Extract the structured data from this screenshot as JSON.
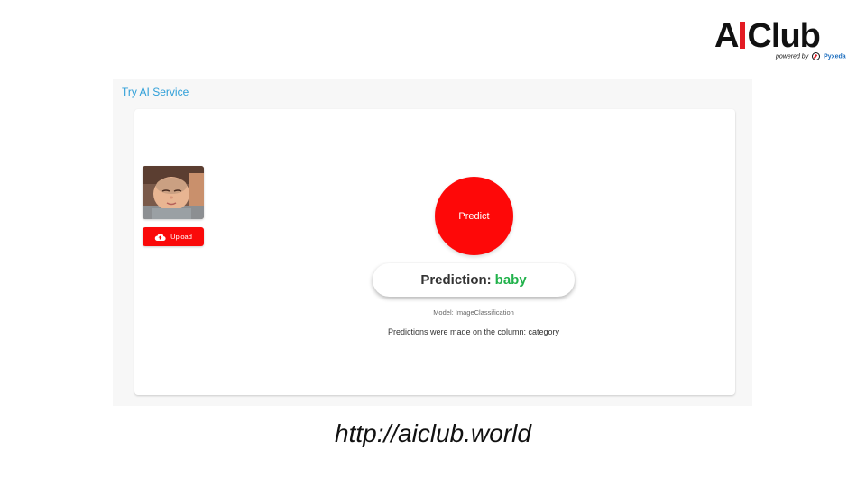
{
  "logo": {
    "brand_prefix": "A",
    "brand_suffix": "Club",
    "powered_by": "powered by",
    "partner": "Pyxeda",
    "accent_color": "#e31b23"
  },
  "panel": {
    "title": "Try AI Service"
  },
  "upload": {
    "label": "Upload",
    "icon": "cloud-upload-icon",
    "image_alt": "baby"
  },
  "predict": {
    "label": "Predict",
    "color": "#fe0808"
  },
  "prediction": {
    "label": "Prediction:",
    "value": "baby",
    "value_color": "#21b24b"
  },
  "model": {
    "text": "Model: ImageClassification"
  },
  "column": {
    "text": "Predictions were made on the column: category"
  },
  "footer": {
    "url": "http://aiclub.world"
  }
}
